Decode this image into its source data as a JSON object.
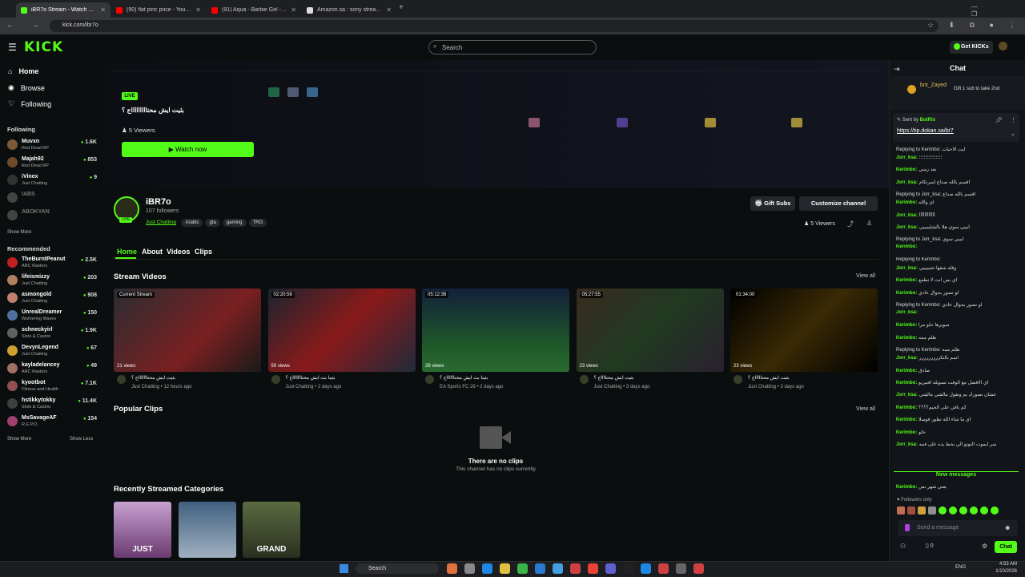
{
  "browser": {
    "tabs": [
      {
        "title": "iBR7o Stream - Watch Live on Kick",
        "color": "#53fc18"
      },
      {
        "title": "(90) flat pinc price - YouTube",
        "color": "#ff0000"
      },
      {
        "title": "(91) Aqua - Barbie Girl - YouTube",
        "color": "#ff0000"
      },
      {
        "title": "Amazon.sa : sony stream camera",
        "color": "#dddddd"
      }
    ],
    "url": "kick.com/ibr7o"
  },
  "header": {
    "logo": "KICK",
    "search_placeholder": "Search",
    "get_kicks": "Get KICKs"
  },
  "sidebar": {
    "nav": [
      {
        "label": "Home"
      },
      {
        "label": "Browse"
      },
      {
        "label": "Following"
      }
    ],
    "following_title": "Following",
    "following": [
      {
        "name": "Muvxn",
        "category": "Red Dead RP",
        "viewers": "1.6K",
        "color": "#7a5a3a"
      },
      {
        "name": "Majah92",
        "category": "Red Dead RP",
        "viewers": "853",
        "color": "#6d4a2a"
      },
      {
        "name": "iVinex",
        "category": "Just Chatting",
        "viewers": "9",
        "color": "#333"
      },
      {
        "name": "IABS",
        "category": "",
        "viewers": "",
        "color": "#444"
      },
      {
        "name": "ABOKYAN",
        "category": "",
        "viewers": "",
        "color": "#444"
      }
    ],
    "show_more_1": "Show More",
    "recommended_title": "Recommended",
    "recommended": [
      {
        "name": "TheBurntPeanut",
        "category": "ARC Raiders",
        "viewers": "2.5K",
        "color": "#c02020"
      },
      {
        "name": "lifeismizzy",
        "category": "Just Chatting",
        "viewers": "203",
        "color": "#b08060"
      },
      {
        "name": "asmongold",
        "category": "Just Chatting",
        "viewers": "908",
        "color": "#c08070"
      },
      {
        "name": "UnrealDreamer",
        "category": "Wuthering Waves",
        "viewers": "150",
        "color": "#5070a0"
      },
      {
        "name": "schneckyirl",
        "category": "Slots & Casino",
        "viewers": "1.9K",
        "color": "#606060"
      },
      {
        "name": "DevynLegend",
        "category": "Just Chatting",
        "viewers": "67",
        "color": "#d0a030"
      },
      {
        "name": "kayladelancey",
        "category": "ARC Raiders",
        "viewers": "49",
        "color": "#a07060"
      },
      {
        "name": "kyootbot",
        "category": "Fitness and Health",
        "viewers": "7.1K",
        "color": "#905050"
      },
      {
        "name": "hstikkytokky",
        "category": "Slots & Casino",
        "viewers": "11.4K",
        "color": "#404040"
      },
      {
        "name": "MsSavageAF",
        "category": "R.E.P.O.",
        "viewers": "154",
        "color": "#a04070"
      }
    ],
    "show_more_2": "Show More",
    "show_less": "Show Less"
  },
  "stream": {
    "live": "LIVE",
    "title": "بثيت ايش محتاااااااااج ؟",
    "viewers": "5 Viewers",
    "watch_now": "Watch now"
  },
  "channel": {
    "name": "iBR7o",
    "followers": "107 followers",
    "category": "Just Chatting",
    "tags": [
      "Arabic",
      "gta",
      "gaming",
      "TRG"
    ],
    "gift_subs": "Gift Subs",
    "customize": "Customize channel",
    "viewers": "5 Viewers",
    "tabs": [
      "Home",
      "About",
      "Videos",
      "Clips"
    ]
  },
  "stream_videos": {
    "title": "Stream Videos",
    "view_all": "View all",
    "items": [
      {
        "badge": "Current Stream",
        "views": "21 views",
        "title": "بثيت ايش محتاااااااج ؟",
        "meta": "Just Chatting • 12 hours ago",
        "bg": "linear-gradient(135deg,#2a2d33,#7a2020 60%,#1a1a1a)"
      },
      {
        "badge": "02:20:56",
        "views": "50 views",
        "title": "بثينا بث ايش محتاااااااج ؟",
        "meta": "Just Chatting • 2 days ago",
        "bg": "linear-gradient(135deg,#1b2430,#8a1a1a 50%,#202a3a)"
      },
      {
        "badge": "05:12:36",
        "views": "28 views",
        "title": "بثينا بث ايش محتااااااج ؟",
        "meta": "EA Sports FC 26 • 2 days ago",
        "bg": "linear-gradient(180deg,#13203a,#1f5a2a 70%,#2a6a30)"
      },
      {
        "badge": "05:27:55",
        "views": "23 views",
        "title": "بثيت ايش محتااااج ؟",
        "meta": "Just Chatting • 3 days ago",
        "bg": "linear-gradient(135deg,#3a2a20,#203a20 50%,#2a2030)"
      },
      {
        "badge": "01:34:00",
        "views": "23 views",
        "title": "بثيت ايش محتاااااج ؟",
        "meta": "Just Chatting • 3 days ago",
        "bg": "linear-gradient(135deg,#000,#3a2a05 50%,#000)"
      }
    ]
  },
  "popular_clips": {
    "title": "Popular Clips",
    "view_all": "View all",
    "empty_title": "There are no clips",
    "empty_sub": "This channel has no clips currently"
  },
  "recent_categories": {
    "title": "Recently Streamed Categories",
    "items": [
      {
        "label": "JUST",
        "bg": "linear-gradient(180deg,#c7a0d0,#6a3a70)"
      },
      {
        "label": "",
        "bg": "linear-gradient(180deg,#406080,#a0b0c0)"
      },
      {
        "label": "GRAND",
        "bg": "linear-gradient(180deg,#5a6a40,#2a3020)"
      }
    ]
  },
  "chat": {
    "title": "Chat",
    "pinned_user": "bnt_Zayed",
    "pinned_text": "Gift 1 sub to take 2nd",
    "sent_by": "Sent by",
    "bot": "BotRix",
    "bot_link": "https://tip.dokan.sa/br7",
    "messages": [
      {
        "reply": "Replying to Kerimbo: ايت الاحبات",
        "user": "Jorr_ksa:",
        "text": "؛؛؛؛؛؛؛؛؛؛؛؛؛؛؛"
      },
      {
        "reply": "",
        "user": "Kerimbo:",
        "text": "بعد زمني"
      },
      {
        "reply": "",
        "user": "Jorr_ksa:",
        "text": "اقسم بالله صداع اسرتكام"
      },
      {
        "reply": "Replying to Jorr_ksa: اقسم بالله صداع",
        "user": "Kerimbo:",
        "text": "اي والله"
      },
      {
        "reply": "",
        "user": "Jorr_ksa:",
        "text": "أأأأأأأأأأأأ"
      },
      {
        "reply": "",
        "user": "Jorr_ksa:",
        "text": "ايييي سوي هلا بالشليييييي"
      },
      {
        "reply": "Replying to Jorr_ksa: ايييي سوي",
        "user": "Kerimbo:",
        "text": ""
      },
      {
        "reply": "Replying to Kerimbo:",
        "user": "Jorr_ksa:",
        "text": "وقله شقها ثجيييييي"
      },
      {
        "reply": "",
        "user": "Kerimbo:",
        "text": "اي بس انت لا تطمع"
      },
      {
        "reply": "",
        "user": "Kerimbo:",
        "text": "لو تصور بجوال عادي"
      },
      {
        "reply": "Replying to Kerimbo: لو تصور بجوال عادي",
        "user": "Jorr_ksa:",
        "text": ""
      },
      {
        "reply": "",
        "user": "Kerimbo:",
        "text": "سويرها حلو مرا"
      },
      {
        "reply": "",
        "user": "Kerimbo:",
        "text": "ظلم ممه"
      },
      {
        "reply": "Replying to Kerimbo: ظلم ممه",
        "user": "Jorr_ksa:",
        "text": "اسم بالتكررررررررر"
      },
      {
        "reply": "",
        "user": "Kerimbo:",
        "text": "صادق"
      },
      {
        "reply": "",
        "user": "Kerimbo:",
        "text": "اي الافضل مع الوقت تسويله افتيريو"
      },
      {
        "reply": "",
        "user": "Jorr_ksa:",
        "text": "عشان تصورك يم وتقول مالشي مالشي"
      },
      {
        "reply": "",
        "user": "Kerimbo:",
        "text": "كم باقي على الجيم؟؟؟؟"
      },
      {
        "reply": "",
        "user": "Kerimbo:",
        "text": "اي ما شاء الله تطور قوسلا"
      },
      {
        "reply": "",
        "user": "Kerimbo:",
        "text": "خلو"
      },
      {
        "reply": "",
        "user": "Jorr_ksa:",
        "text": "سر ايموت التوتو الي يحط يده على فمه"
      }
    ],
    "new_messages": "New messages",
    "last_user": "Kerimbo:",
    "last_text": "يعني شهر بس",
    "followers_only": "Followers only",
    "send_placeholder": "Send a message",
    "count": "0",
    "chat_button": "Chat"
  },
  "taskbar": {
    "search": "Search",
    "lang": "ENG",
    "time": "4:53 AM",
    "date": "1/10/2026"
  }
}
